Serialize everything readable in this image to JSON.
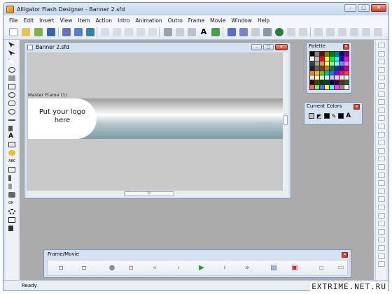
{
  "app": {
    "title": "Alligator Flash Designer - Banner 2.sfd",
    "window_buttons": [
      "–",
      "□",
      "✕"
    ]
  },
  "menu": [
    "File",
    "Edit",
    "Insert",
    "View",
    "Item",
    "Action",
    "Intro",
    "Animation",
    "Outro",
    "Frame",
    "Movie",
    "Window",
    "Help"
  ],
  "document": {
    "title": "Banner 2.sfd",
    "frame_label": "Master Frame (1)",
    "logo_text_line1": "Put your logo",
    "logo_text_line2": "here",
    "scroll_grip": "III"
  },
  "palette": {
    "title": "Palette",
    "close": "✕",
    "colors": [
      "#000000",
      "#808080",
      "#800000",
      "#808000",
      "#008000",
      "#008080",
      "#000080",
      "#800080",
      "#ffffff",
      "#c0c0c0",
      "#ff0000",
      "#ffff00",
      "#00ff00",
      "#00ffff",
      "#0000ff",
      "#ff00ff",
      "#404040",
      "#a0a0a0",
      "#ff8040",
      "#ffff80",
      "#80ff80",
      "#80ffff",
      "#8080ff",
      "#ff80ff",
      "#202020",
      "#606060",
      "#804000",
      "#c08000",
      "#008040",
      "#004080",
      "#4000c0",
      "#c00080",
      "#ff8000",
      "#ffc000",
      "#80c000",
      "#00c080",
      "#0080ff",
      "#8000ff",
      "#ff0080",
      "#ff4040",
      "#ffe0c0",
      "#ffffc0",
      "#c0ffc0",
      "#c0ffff",
      "#c0c0ff",
      "#ffc0ff",
      "#e0e0e0",
      "#f0f0f0",
      "#400000",
      "#404000",
      "#004000",
      "#004040",
      "#000040",
      "#400040",
      "#603020",
      "#306030",
      "#ff6060",
      "#60ff60",
      "#6060ff",
      "#ffff40",
      "#40ffff",
      "#ff40ff",
      "#909090",
      "#ffffff"
    ]
  },
  "current_colors": {
    "title": "Current Colors",
    "close": "✕",
    "swatches": [
      "#c0c0c0",
      "#000000",
      "#000000"
    ],
    "text_icon": "A"
  },
  "frame_movie": {
    "title": "Frame/Movie",
    "close": "✕",
    "buttons": [
      {
        "name": "new-frame-icon",
        "glyph": "▫",
        "color": "#333333"
      },
      {
        "name": "frame-order-icon",
        "glyph": "▫",
        "color": "#333333"
      },
      {
        "name": "record-icon",
        "glyph": "●",
        "color": "#8a8a8a"
      },
      {
        "name": "delete-frame-icon",
        "glyph": "▫",
        "color": "#c02020"
      },
      {
        "name": "rewind-icon",
        "glyph": "«",
        "color": "#8a8a8a"
      },
      {
        "name": "previous-frame-icon",
        "glyph": "‹",
        "color": "#8a8a8a"
      },
      {
        "name": "play-icon",
        "glyph": "▶",
        "color": "#1f9a2b"
      },
      {
        "name": "next-frame-icon",
        "glyph": "›",
        "color": "#1d6bb5"
      },
      {
        "name": "fast-forward-icon",
        "glyph": "»",
        "color": "#1d6bb5"
      },
      {
        "name": "frame-properties-icon",
        "glyph": "▤",
        "color": "#4a5fa0"
      },
      {
        "name": "export-icon",
        "glyph": "▣",
        "color": "#c03030"
      },
      {
        "name": "preview-frame-icon",
        "glyph": "▫",
        "color": "#888888"
      },
      {
        "name": "frame-strip-icon",
        "glyph": "▭",
        "color": "#888888"
      }
    ]
  },
  "status": {
    "text": "Ready"
  },
  "watermark": "EXTRIME.NET.RU"
}
